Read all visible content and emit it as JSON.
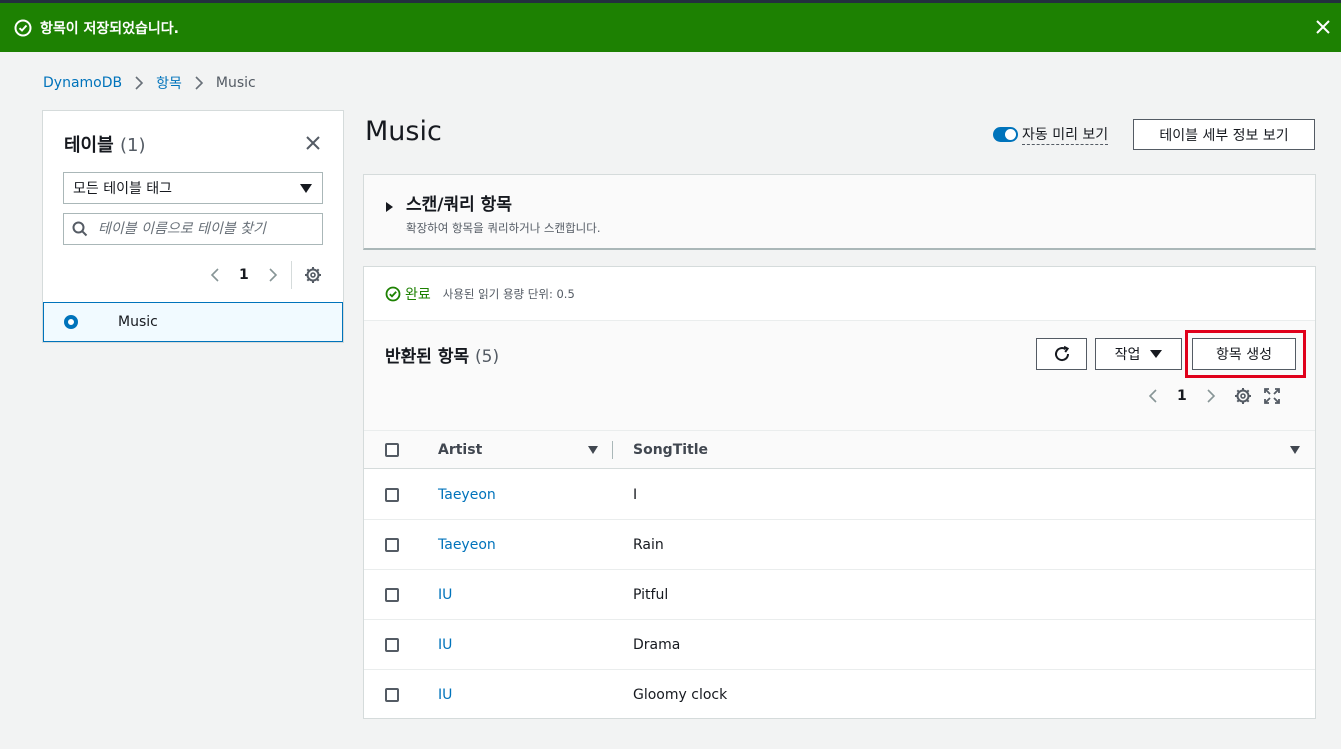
{
  "flash": {
    "message": "항목이 저장되었습니다."
  },
  "breadcrumb": {
    "items": [
      "DynamoDB",
      "항목"
    ],
    "current": "Music"
  },
  "left_panel": {
    "title": "테이블",
    "count": "(1)",
    "filter_select": "모든 테이블 태그",
    "search_placeholder": "테이블 이름으로 테이블 찾기",
    "page": "1",
    "tables": [
      {
        "name": "Music",
        "selected": true
      }
    ]
  },
  "main": {
    "title": "Music",
    "auto_preview_label": "자동 미리 보기",
    "auto_preview_on": true,
    "details_button": "테이블 세부 정보 보기"
  },
  "scan_panel": {
    "title": "스캔/쿼리 항목",
    "description": "확장하여 항목을 쿼리하거나 스캔합니다."
  },
  "results": {
    "status": "완료",
    "status_note": "사용된 읽기 용량 단위: 0.5",
    "title": "반환된 항목",
    "count": "(5)",
    "actions_button": "작업",
    "create_button": "항목 생성",
    "page": "1",
    "columns": [
      "Artist",
      "SongTitle"
    ],
    "rows": [
      {
        "artist": "Taeyeon",
        "song": "I"
      },
      {
        "artist": "Taeyeon",
        "song": "Rain"
      },
      {
        "artist": "IU",
        "song": "Pitful"
      },
      {
        "artist": "IU",
        "song": "Drama"
      },
      {
        "artist": "IU",
        "song": "Gloomy clock"
      }
    ]
  },
  "colors": {
    "success_green": "#1d8102",
    "link_blue": "#0073bb",
    "highlight_red": "#e0001b"
  }
}
